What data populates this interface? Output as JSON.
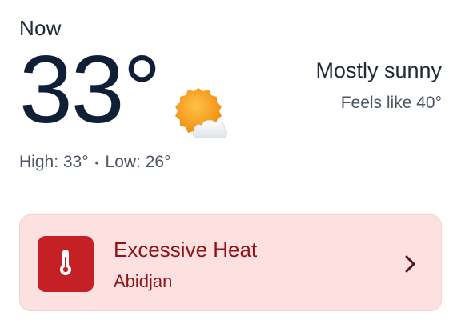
{
  "current": {
    "label": "Now",
    "temperature": "33°",
    "high": "High: 33°",
    "separator": "•",
    "low": "Low: 26°",
    "condition": "Mostly sunny",
    "feels_like": "Feels like 40°",
    "icon": "sun-behind-cloud-icon"
  },
  "alert": {
    "title": "Excessive Heat",
    "location": "Abidjan",
    "icon": "thermometer-icon",
    "chevron_icon": "chevron-right-icon",
    "colors": {
      "background": "#fde1e1",
      "icon_box": "#c52026",
      "text": "#8f1418"
    }
  }
}
